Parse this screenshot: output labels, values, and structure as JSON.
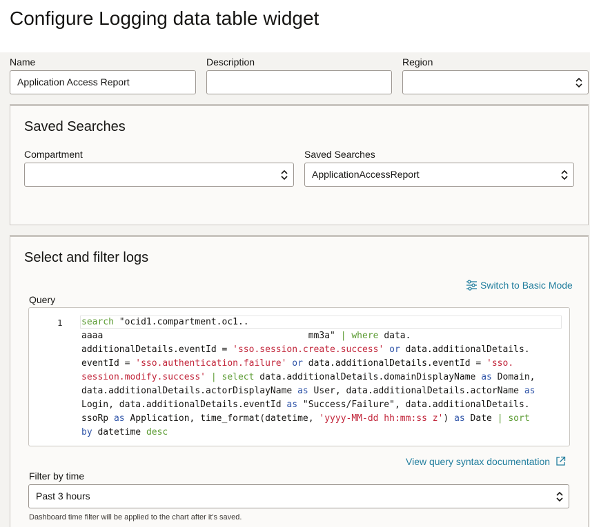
{
  "header": {
    "title": "Configure Logging data table widget"
  },
  "form": {
    "name_label": "Name",
    "name_value": "Application Access Report",
    "description_label": "Description",
    "description_value": "",
    "region_label": "Region",
    "region_value": ""
  },
  "saved_searches_panel": {
    "title": "Saved Searches",
    "compartment_label": "Compartment",
    "compartment_value": "",
    "saved_searches_label": "Saved Searches",
    "saved_searches_value": "ApplicationAccessReport"
  },
  "logs_panel": {
    "title": "Select and filter logs",
    "switch_mode_label": "Switch to Basic Mode",
    "query_label": "Query",
    "line_number": "1",
    "query_lines": [
      [
        [
          "kw",
          "search"
        ],
        [
          "pl",
          " \"ocid1.compartment.oc1.."
        ]
      ],
      [
        [
          "pl",
          "aaaa"
        ],
        [
          "pl",
          "                                      "
        ],
        [
          "pl",
          "mm3a\" "
        ],
        [
          "kw",
          "|"
        ],
        [
          "pl",
          " "
        ],
        [
          "kw",
          "where"
        ],
        [
          "pl",
          " data."
        ]
      ],
      [
        [
          "pl",
          "additionalDetails.eventId = "
        ],
        [
          "str",
          "'sso.session.create.success'"
        ],
        [
          "pl",
          " "
        ],
        [
          "op",
          "or"
        ],
        [
          "pl",
          " data.additionalDetails."
        ]
      ],
      [
        [
          "pl",
          "eventId = "
        ],
        [
          "str",
          "'sso.authentication.failure'"
        ],
        [
          "pl",
          " "
        ],
        [
          "op",
          "or"
        ],
        [
          "pl",
          " data.additionalDetails.eventId = "
        ],
        [
          "str",
          "'sso."
        ]
      ],
      [
        [
          "str",
          "session.modify.success'"
        ],
        [
          "pl",
          " "
        ],
        [
          "kw",
          "|"
        ],
        [
          "pl",
          " "
        ],
        [
          "kw",
          "select"
        ],
        [
          "pl",
          " data.additionalDetails.domainDisplayName "
        ],
        [
          "op",
          "as"
        ],
        [
          "pl",
          " Domain,"
        ]
      ],
      [
        [
          "pl",
          "data.additionalDetails.actorDisplayName "
        ],
        [
          "op",
          "as"
        ],
        [
          "pl",
          " User, data.additionalDetails.actorName "
        ],
        [
          "op",
          "as"
        ]
      ],
      [
        [
          "pl",
          "Login, data.additionalDetails.eventId "
        ],
        [
          "op",
          "as"
        ],
        [
          "pl",
          " \"Success/Failure\", data.additionalDetails."
        ]
      ],
      [
        [
          "pl",
          "ssoRp "
        ],
        [
          "op",
          "as"
        ],
        [
          "pl",
          " Application, time_format(datetime, "
        ],
        [
          "str",
          "'yyyy-MM-dd hh:mm:ss z'"
        ],
        [
          "pl",
          ") "
        ],
        [
          "op",
          "as"
        ],
        [
          "pl",
          " Date "
        ],
        [
          "kw",
          "|"
        ],
        [
          "pl",
          " "
        ],
        [
          "kw",
          "sort"
        ]
      ],
      [
        [
          "op",
          "by"
        ],
        [
          "pl",
          " datetime "
        ],
        [
          "kw",
          "desc"
        ]
      ]
    ],
    "docs_link_label": "View query syntax documentation",
    "filter_time_label": "Filter by time",
    "filter_time_value": "Past 3 hours",
    "filter_help": "Dashboard time filter will be applied to the chart after it's saved."
  },
  "colors": {
    "link": "#227e9e",
    "keyword": "#5b9b32",
    "operator": "#2f54a8",
    "string": "#c2263b"
  },
  "icons": {
    "select": "chevron-up-down-icon",
    "switch_mode": "sliders-icon",
    "external_link": "external-link-icon"
  }
}
